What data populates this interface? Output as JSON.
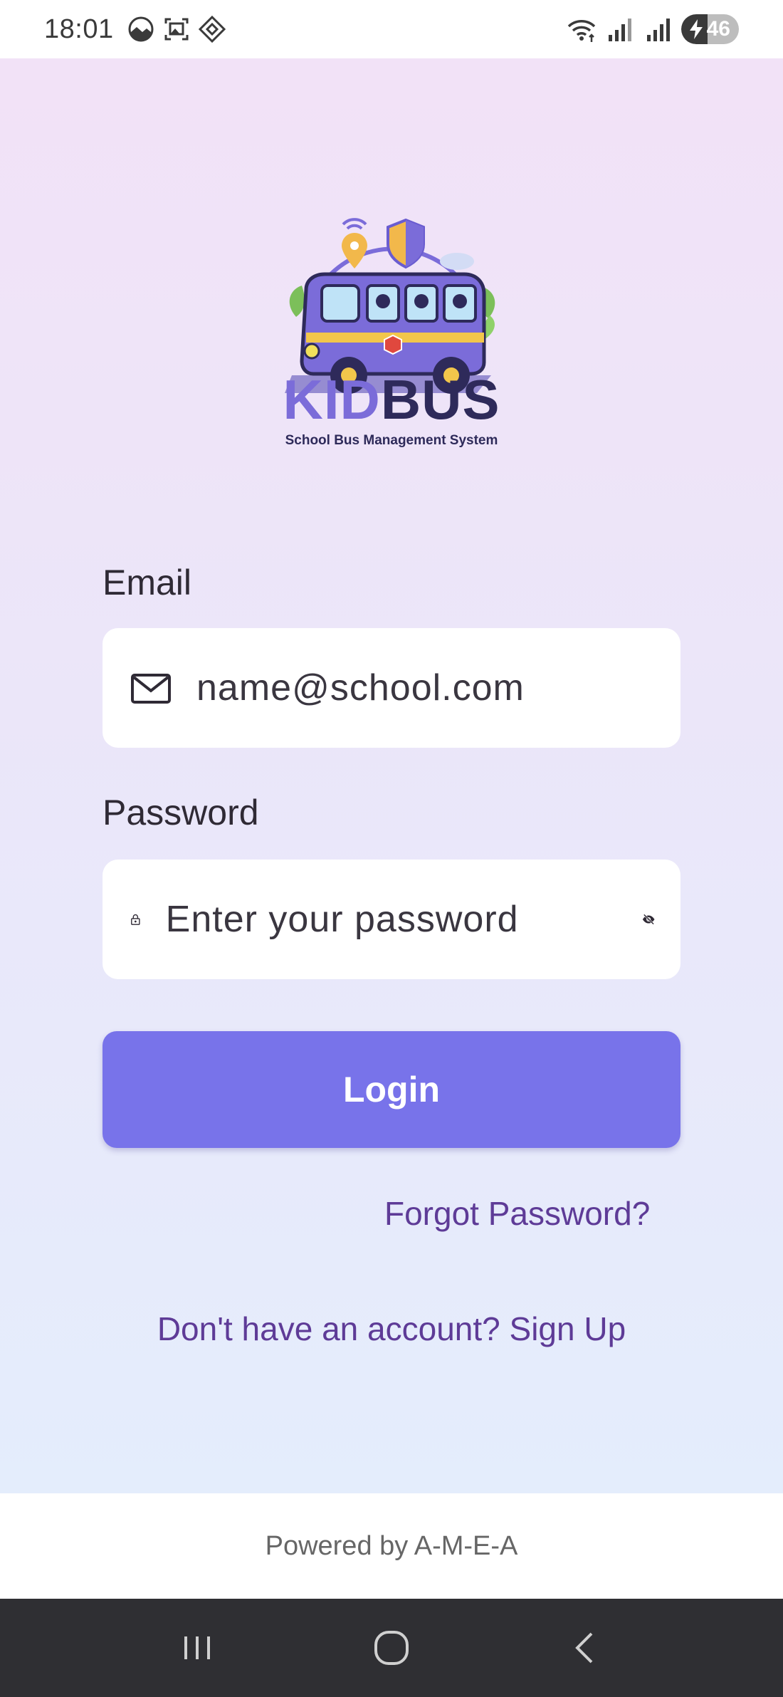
{
  "status_bar": {
    "time": "18:01",
    "battery_level": "46",
    "icons": [
      "photo-icon",
      "screenshot-icon",
      "diamond-app-icon",
      "wifi-icon",
      "signal-icon",
      "signal-icon-2",
      "battery-charging-icon"
    ]
  },
  "branding": {
    "logo_name_part1": "KID",
    "logo_name_part2": "BUS",
    "logo_tagline": "School Bus Management System"
  },
  "form": {
    "email_label": "Email",
    "email_placeholder": "name@school.com",
    "password_label": "Password",
    "password_placeholder": "Enter your password",
    "login_label": "Login",
    "forgot_label": "Forgot Password?",
    "signup_label": "Don't have an account? Sign Up"
  },
  "footer": {
    "text": "Powered by A-M-E-A"
  },
  "colors": {
    "primary": "#7873ea",
    "link": "#5e3b97",
    "gradient_top": "#f2e2f7",
    "gradient_bottom": "#e4edfc"
  }
}
